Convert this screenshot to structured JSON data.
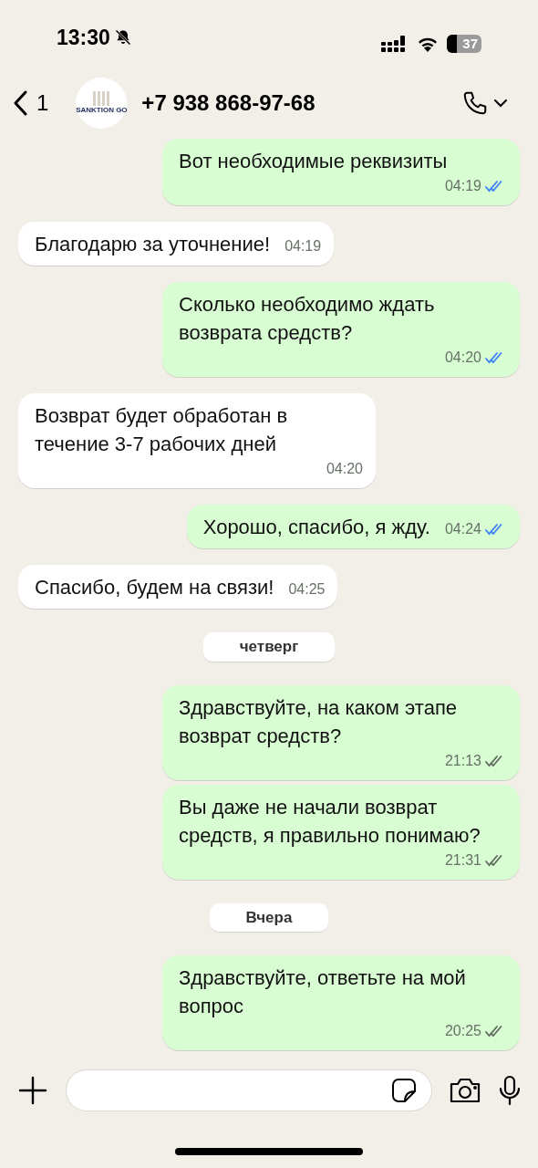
{
  "status_bar": {
    "time": "13:30",
    "battery": "37"
  },
  "header": {
    "back_count": "1",
    "avatar_label": "SANKTION GO",
    "contact": "+7 938 868-97-68"
  },
  "messages": [
    {
      "kind": "message",
      "outgoing": true,
      "text": "Вот необходимые реквизиты",
      "time": "04:19",
      "read": true
    },
    {
      "kind": "message",
      "outgoing": false,
      "text": "Благодарю за уточнение!",
      "time": "04:19"
    },
    {
      "kind": "message",
      "outgoing": true,
      "text": "Сколько необходимо ждать возврата средств?",
      "time": "04:20",
      "read": true
    },
    {
      "kind": "message",
      "outgoing": false,
      "text": "Возврат будет обработан в течение 3-7 рабочих дней",
      "time": "04:20"
    },
    {
      "kind": "message",
      "outgoing": true,
      "text": "Хорошо, спасибо, я жду.",
      "time": "04:24",
      "read": true
    },
    {
      "kind": "message",
      "outgoing": false,
      "text": "Спасибо, будем на связи!",
      "time": "04:25"
    },
    {
      "kind": "date",
      "label": "четверг"
    },
    {
      "kind": "message",
      "outgoing": true,
      "text": "Здравствуйте, на каком этапе возврат средств?",
      "time": "21:13",
      "read": false
    },
    {
      "kind": "message",
      "outgoing": true,
      "text": "Вы даже не начали возврат средств, я правильно понимаю?",
      "time": "21:31",
      "read": false
    },
    {
      "kind": "date",
      "label": "Вчера"
    },
    {
      "kind": "message",
      "outgoing": true,
      "text": "Здравствуйте, ответьте на мой вопрос",
      "time": "20:25",
      "read": false
    }
  ]
}
